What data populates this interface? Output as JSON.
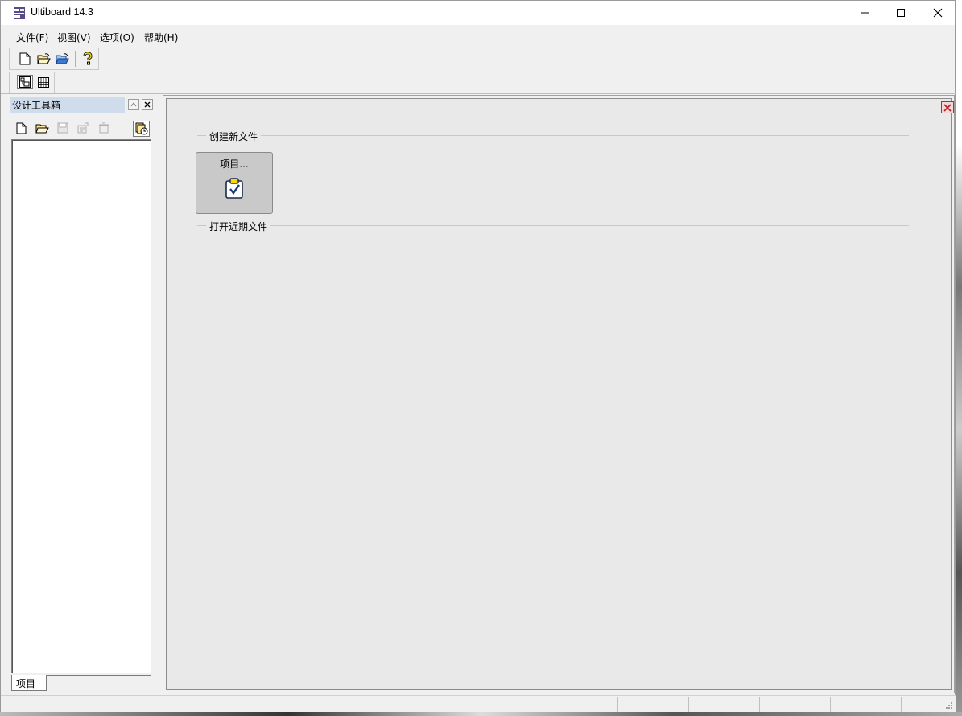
{
  "window": {
    "title": "Ultiboard 14.3",
    "icon": "ultiboard-app-icon",
    "controls": {
      "minimize": "minimize-icon",
      "maximize": "maximize-icon",
      "close": "close-icon"
    }
  },
  "menu": [
    {
      "label": "文件(F)"
    },
    {
      "label": "视图(V)"
    },
    {
      "label": "选项(O)"
    },
    {
      "label": "帮助(H)"
    }
  ],
  "toolbar_main": [
    "new-file-icon",
    "open-file-icon",
    "open-project-icon",
    "help-icon"
  ],
  "toolbar_view": [
    "design-toolbox-view-icon",
    "spreadsheet-view-icon"
  ],
  "design_toolbox": {
    "title": "设计工具箱",
    "tools": [
      "new-icon",
      "open-icon",
      "save-icon",
      "properties-icon",
      "delete-icon",
      "recent-project-icon"
    ],
    "tab": "项目"
  },
  "start_page": {
    "create_section": "创建新文件",
    "project_button": "项目...",
    "recent_section": "打开近期文件"
  },
  "colors": {
    "accent_title": "#cfdcec",
    "close_doc": "#c03030"
  }
}
